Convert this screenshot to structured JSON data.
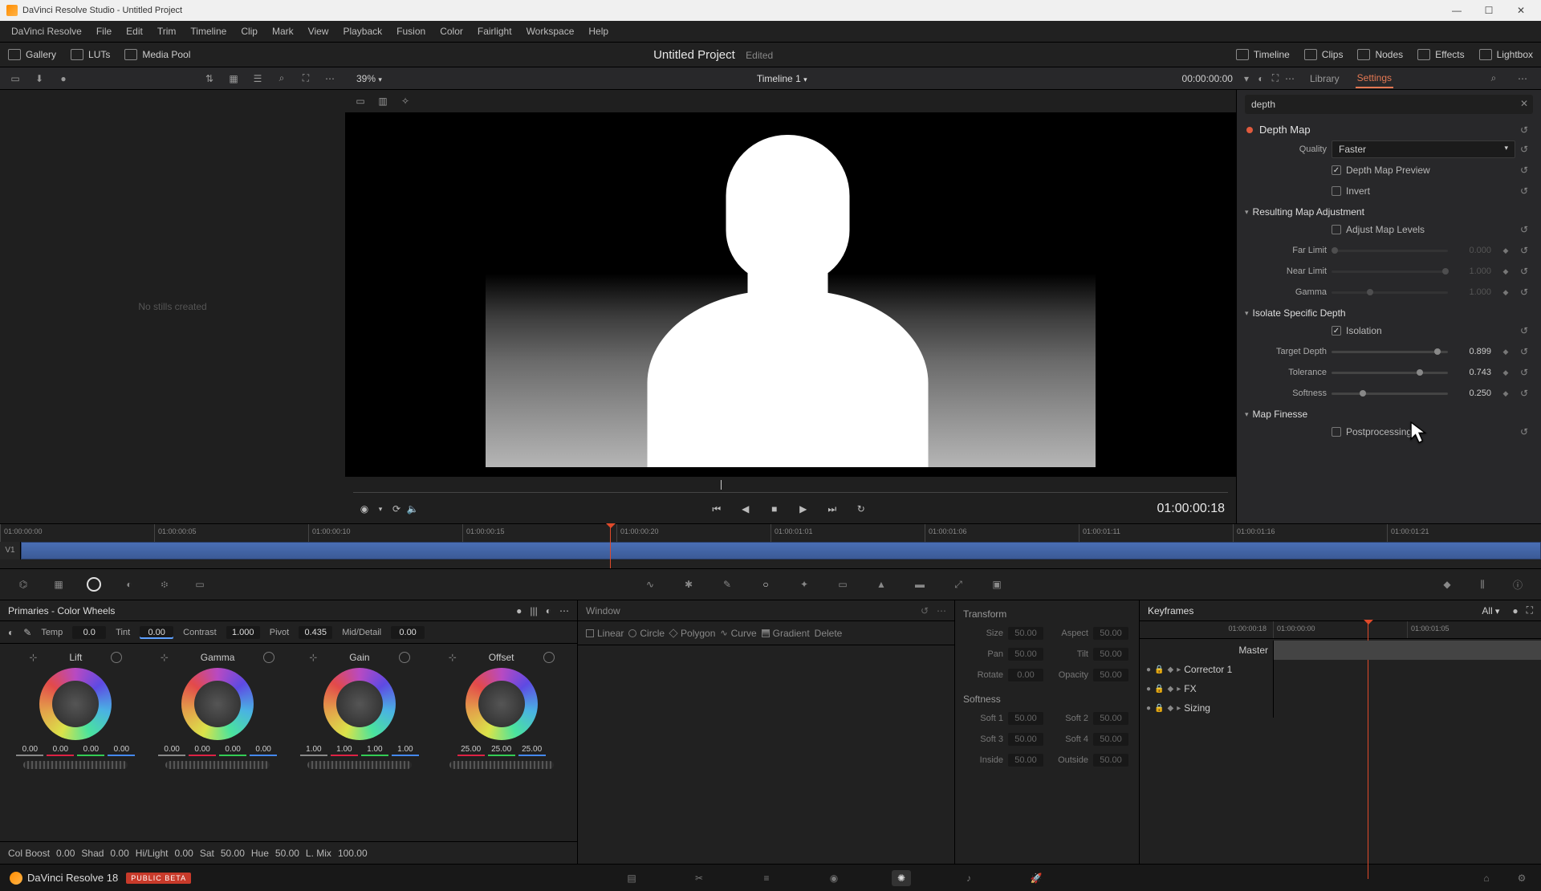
{
  "titlebar": {
    "text": "DaVinci Resolve Studio - Untitled Project"
  },
  "menu": [
    "DaVinci Resolve",
    "File",
    "Edit",
    "Trim",
    "Timeline",
    "Clip",
    "Mark",
    "View",
    "Playback",
    "Fusion",
    "Color",
    "Fairlight",
    "Workspace",
    "Help"
  ],
  "topbar": {
    "gallery": "Gallery",
    "luts": "LUTs",
    "mediapool": "Media Pool",
    "project": "Untitled Project",
    "edited": "Edited",
    "timeline": "Timeline",
    "clips": "Clips",
    "nodes": "Nodes",
    "effects": "Effects",
    "lightbox": "Lightbox"
  },
  "toolbar": {
    "zoom": "39%",
    "timeline_name": "Timeline 1",
    "tc": "00:00:00:00",
    "library": "Library",
    "settings": "Settings"
  },
  "gallery_empty": "No stills created",
  "transport": {
    "tc": "01:00:00:18"
  },
  "inspector": {
    "search": "depth",
    "title": "Depth Map",
    "quality_label": "Quality",
    "quality_value": "Faster",
    "preview": "Depth Map Preview",
    "invert": "Invert",
    "sec_result": "Resulting Map Adjustment",
    "adjust_levels": "Adjust Map Levels",
    "far_label": "Far Limit",
    "far_val": "0.000",
    "near_label": "Near Limit",
    "near_val": "1.000",
    "gamma_label": "Gamma",
    "gamma_val": "1.000",
    "sec_isolate": "Isolate Specific Depth",
    "isolation": "Isolation",
    "target_label": "Target Depth",
    "target_val": "0.899",
    "tol_label": "Tolerance",
    "tol_val": "0.743",
    "soft_label": "Softness",
    "soft_val": "0.250",
    "sec_finesse": "Map Finesse",
    "post": "Postprocessing"
  },
  "timeline_ruler": [
    "01:00:00:00",
    "01:00:00:05",
    "01:00:00:10",
    "01:00:00:15",
    "01:00:00:20",
    "01:00:01:01",
    "01:00:01:06",
    "01:00:01:11",
    "01:00:01:16",
    "01:00:01:21"
  ],
  "track": "V1",
  "primaries": {
    "title": "Primaries - Color Wheels",
    "temp": "Temp",
    "temp_v": "0.0",
    "tint": "Tint",
    "tint_v": "0.00",
    "contrast": "Contrast",
    "contrast_v": "1.000",
    "pivot": "Pivot",
    "pivot_v": "0.435",
    "md": "Mid/Detail",
    "md_v": "0.00",
    "wheels": [
      {
        "name": "Lift",
        "vals": [
          "0.00",
          "0.00",
          "0.00",
          "0.00"
        ]
      },
      {
        "name": "Gamma",
        "vals": [
          "0.00",
          "0.00",
          "0.00",
          "0.00"
        ]
      },
      {
        "name": "Gain",
        "vals": [
          "1.00",
          "1.00",
          "1.00",
          "1.00"
        ]
      },
      {
        "name": "Offset",
        "vals": [
          "25.00",
          "25.00",
          "25.00"
        ]
      }
    ],
    "colboost": "Col Boost",
    "colboost_v": "0.00",
    "shad": "Shad",
    "shad_v": "0.00",
    "hilight": "Hi/Light",
    "hilight_v": "0.00",
    "sat": "Sat",
    "sat_v": "50.00",
    "hue": "Hue",
    "hue_v": "50.00",
    "lmix": "L. Mix",
    "lmix_v": "100.00"
  },
  "window": {
    "head": "Window",
    "linear": "Linear",
    "circle": "Circle",
    "polygon": "Polygon",
    "curve": "Curve",
    "gradient": "Gradient",
    "delete": "Delete"
  },
  "xform": {
    "h1": "Transform",
    "size": "Size",
    "size_v": "50.00",
    "aspect": "Aspect",
    "aspect_v": "50.00",
    "pan": "Pan",
    "pan_v": "50.00",
    "tilt": "Tilt",
    "tilt_v": "50.00",
    "rotate": "Rotate",
    "rotate_v": "0.00",
    "opacity": "Opacity",
    "opacity_v": "50.00",
    "h2": "Softness",
    "s1": "Soft 1",
    "s1_v": "50.00",
    "s2": "Soft 2",
    "s2_v": "50.00",
    "s3": "Soft 3",
    "s3_v": "50.00",
    "s4": "Soft 4",
    "s4_v": "50.00",
    "inside": "Inside",
    "inside_v": "50.00",
    "outside": "Outside",
    "outside_v": "50.00"
  },
  "keyframes": {
    "title": "Keyframes",
    "all": "All",
    "tc": "01:00:00:18",
    "ruler": [
      "01:00:00:00",
      "01:00:01:05"
    ],
    "rows": [
      "Master",
      "Corrector 1",
      "FX",
      "Sizing"
    ]
  },
  "pagebar": {
    "app": "DaVinci Resolve 18",
    "beta": "PUBLIC BETA"
  }
}
